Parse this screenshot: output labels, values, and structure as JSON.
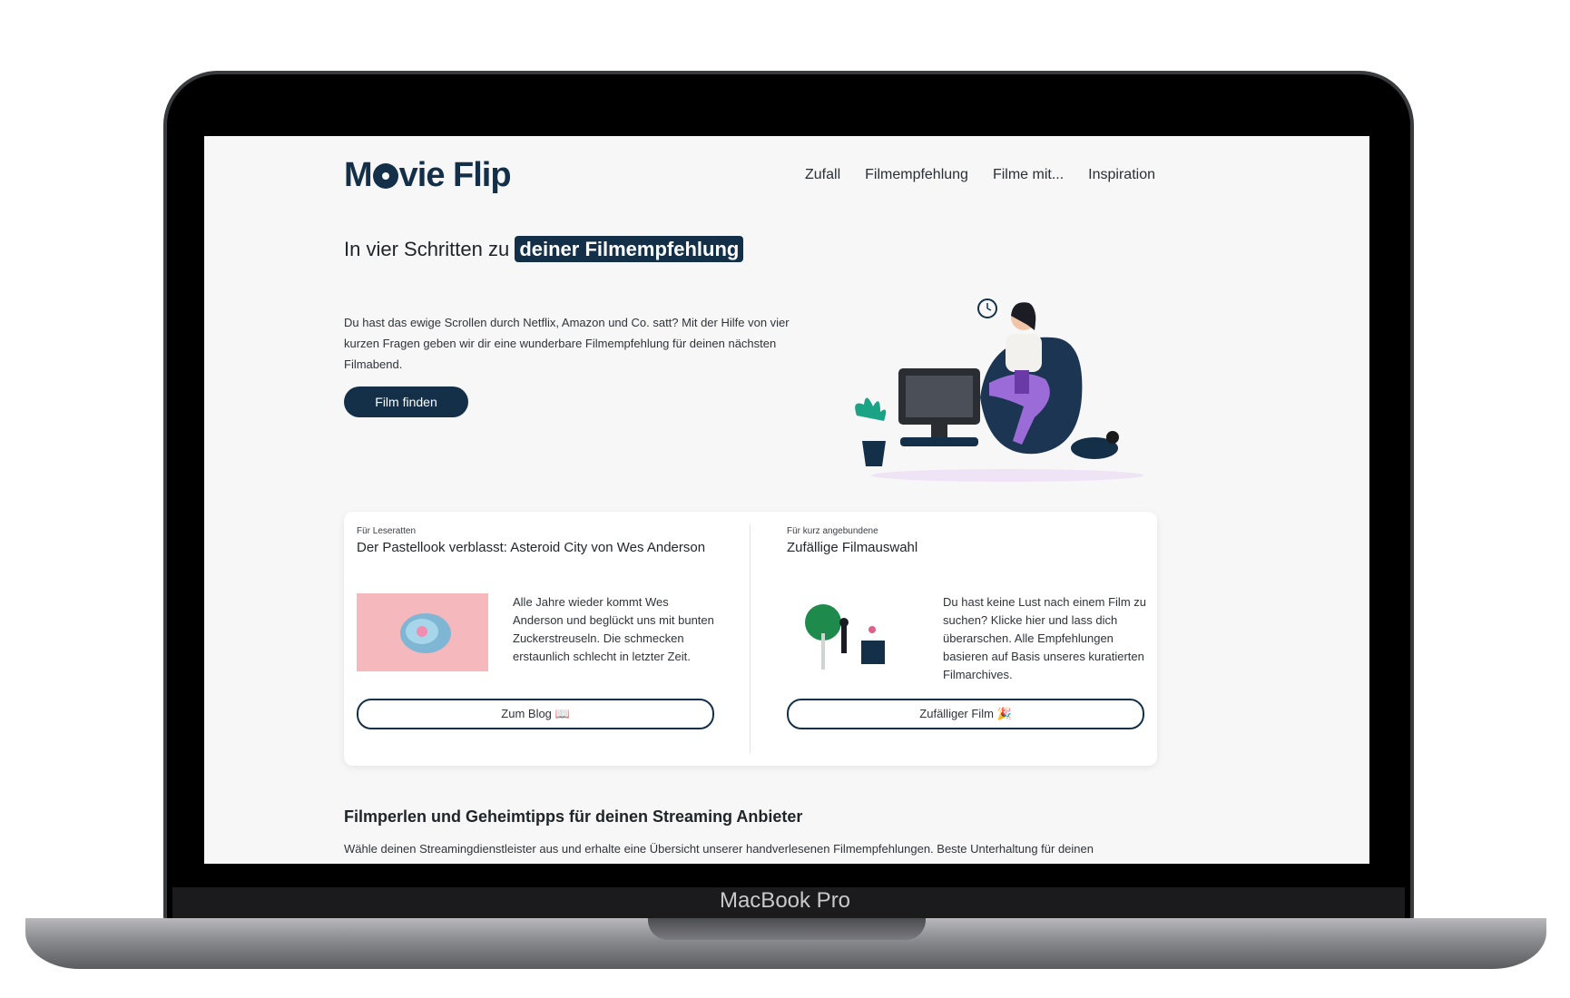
{
  "device": {
    "label": "MacBook Pro"
  },
  "nav": {
    "logo": {
      "part1": "M",
      "part2": "vie Flip"
    },
    "links": [
      "Zufall",
      "Filmempfehlung",
      "Filme mit...",
      "Inspiration"
    ]
  },
  "hero": {
    "title_prefix": "In vier Schritten zu",
    "title_highlight": "deiner Filmempfehlung",
    "text": "Du hast das ewige Scrollen durch Netflix, Amazon und Co. satt? Mit der Hilfe von vier kurzen Fragen geben wir dir eine wunderbare Filmempfehlung für deinen nächsten Filmabend.",
    "button": "Film finden"
  },
  "cards": {
    "left": {
      "eyebrow": "Für Leseratten",
      "title": "Der Pastellook verblasst: Asteroid City von Wes Anderson",
      "text": "Alle Jahre wieder kommt Wes Anderson und beglückt uns mit bunten Zuckerstreuseln. Die schmecken erstaunlich schlecht in letzter Zeit.",
      "button": "Zum Blog 📖"
    },
    "right": {
      "eyebrow": "Für kurz angebundene",
      "title": "Zufällige Filmauswahl",
      "text": "Du hast keine Lust nach einem Film zu suchen? Klicke hier und lass dich überarschen. Alle Empfehlungen basieren auf Basis unseres kuratierten Filmarchives.",
      "button": "Zufälliger Film 🎉"
    }
  },
  "section": {
    "title": "Filmperlen und Geheimtipps für deinen Streaming Anbieter",
    "text": "Wähle deinen Streamingdienstleister aus und erhalte eine Übersicht unserer handverlesenen Filmempfehlungen. Beste Unterhaltung für deinen"
  },
  "colors": {
    "brand": "#143049",
    "background": "#f7f7f7",
    "accent_purple": "#9b6bd8"
  }
}
